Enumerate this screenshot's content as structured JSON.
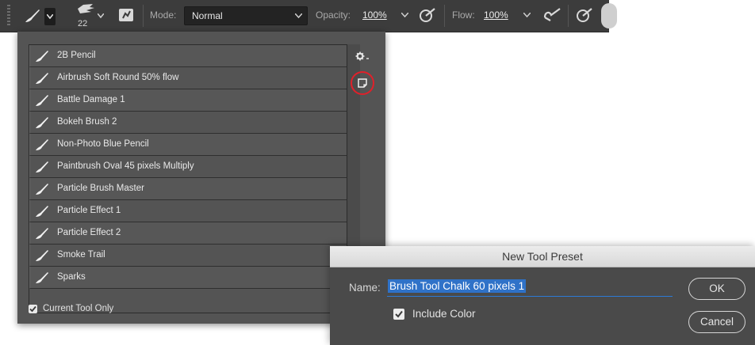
{
  "options_bar": {
    "brush_size": "22",
    "mode_label": "Mode:",
    "mode_value": "Normal",
    "opacity_label": "Opacity:",
    "opacity_value": "100%",
    "flow_label": "Flow:",
    "flow_value": "100%"
  },
  "preset_panel": {
    "items": [
      {
        "label": "2B Pencil"
      },
      {
        "label": "Airbrush Soft Round 50% flow"
      },
      {
        "label": "Battle Damage 1"
      },
      {
        "label": "Bokeh Brush 2"
      },
      {
        "label": "Non-Photo Blue Pencil"
      },
      {
        "label": "Paintbrush Oval 45 pixels Multiply"
      },
      {
        "label": "Particle Brush Master"
      },
      {
        "label": "Particle Effect 1"
      },
      {
        "label": "Particle Effect 2"
      },
      {
        "label": "Smoke Trail"
      },
      {
        "label": "Sparks"
      }
    ],
    "current_tool_only_label": "Current Tool Only",
    "current_tool_only_checked": true
  },
  "dialog": {
    "title": "New Tool Preset",
    "name_label": "Name:",
    "name_value": "Brush Tool Chalk 60 pixels 1",
    "include_color_label": "Include Color",
    "include_color_checked": true,
    "ok_label": "OK",
    "cancel_label": "Cancel"
  },
  "colors": {
    "highlight_circle": "#e0202a",
    "selection": "#2f72c8"
  }
}
